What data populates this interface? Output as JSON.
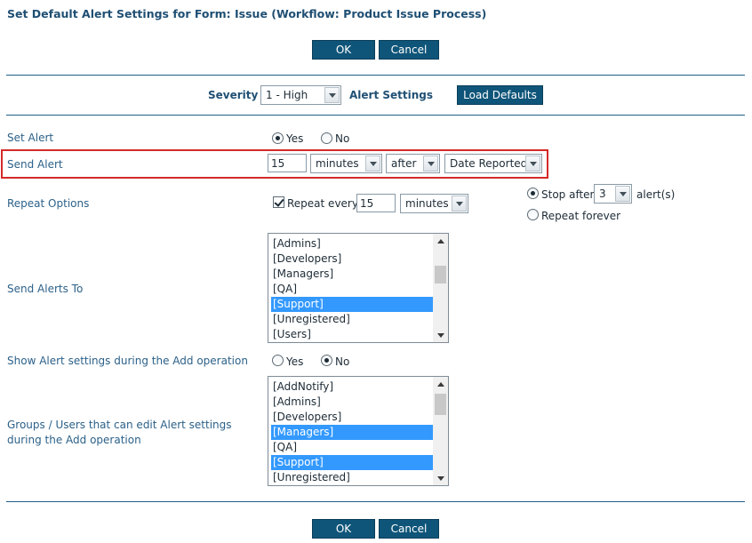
{
  "title": "Set Default Alert Settings for Form: Issue (Workflow: Product Issue Process)",
  "buttons": {
    "ok": "OK",
    "cancel": "Cancel",
    "load_defaults": "Load Defaults"
  },
  "severity": {
    "label": "Severity",
    "value": "1 - High",
    "alert_settings_label": "Alert Settings"
  },
  "set_alert": {
    "label": "Set Alert",
    "yes": "Yes",
    "no": "No",
    "selected": "Yes"
  },
  "send_alert": {
    "label": "Send Alert",
    "number": "15",
    "unit": "minutes",
    "relation": "after",
    "field": "Date Reported"
  },
  "repeat": {
    "label": "Repeat Options",
    "checkbox_label": "Repeat every",
    "checked": true,
    "number": "15",
    "unit": "minutes",
    "stop_after_label": "Stop after",
    "stop_after_value": "3",
    "alerts_suffix": "alert(s)",
    "repeat_forever_label": "Repeat forever",
    "selected": "Stop after"
  },
  "send_alerts_to": {
    "label": "Send Alerts To",
    "items": [
      "[Admins]",
      "[Developers]",
      "[Managers]",
      "[QA]",
      "[Support]",
      "[Unregistered]",
      "[Users]"
    ],
    "selected": [
      "[Support]"
    ]
  },
  "show_alert_settings": {
    "label": "Show Alert settings during the Add operation",
    "yes": "Yes",
    "no": "No",
    "selected": "No"
  },
  "groups_users": {
    "label_line1": "Groups / Users that can edit Alert settings",
    "label_line2": "during the Add operation",
    "items": [
      "[AddNotify]",
      "[Admins]",
      "[Developers]",
      "[Managers]",
      "[QA]",
      "[Support]",
      "[Unregistered]"
    ],
    "selected": [
      "[Managers]",
      "[Support]"
    ]
  },
  "colors": {
    "accent": "#0f5579",
    "label_text": "#2c6189",
    "selection": "#3399ff",
    "highlight_border": "#d42a2a"
  }
}
